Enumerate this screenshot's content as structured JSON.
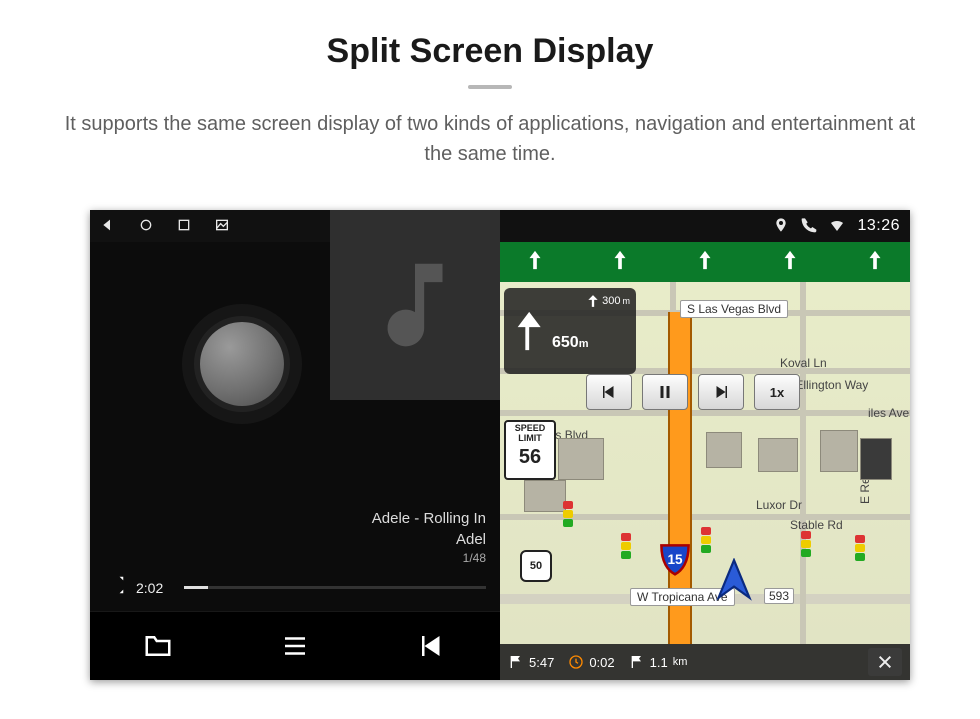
{
  "header": {
    "title": "Split Screen Display",
    "subtitle": "It supports the same screen display of two kinds of applications, navigation and entertainment at the same time."
  },
  "statusbar": {
    "time": "13:26",
    "icons_left": [
      "back-triangle",
      "circle",
      "square",
      "picture"
    ],
    "icons_right": [
      "location-pin",
      "phone",
      "wifi"
    ]
  },
  "music": {
    "track_line1": "Adele - Rolling In",
    "track_line2": "Adel",
    "index": "1/48",
    "elapsed": "2:02",
    "controls": [
      "folder",
      "playlist",
      "prev"
    ]
  },
  "nav": {
    "lane_arrows": 5,
    "turn": {
      "distance": "650",
      "distance_unit": "m",
      "next_distance": "300",
      "next_unit": "m"
    },
    "sim_controls": {
      "prev": "prev",
      "pause": "pause",
      "next": "next",
      "speed": "1x"
    },
    "speed_limit": {
      "label": "SPEED\nLIMIT",
      "value": "56"
    },
    "interstate": "15",
    "us_route": "50",
    "streets": {
      "top": "S Las Vegas Blvd",
      "koval": "Koval Ln",
      "duke": "Duke Ellington Way",
      "vegas_trunc": "Vegas Blvd",
      "luxor": "Luxor Dr",
      "stable": "Stable Rd",
      "reno": "E Reno Ave",
      "bottom": "W Tropicana Ave",
      "bottom_num": "593",
      "miles_trunc": "iles Ave"
    },
    "footer": {
      "eta": "5:47",
      "duration": "0:02",
      "distance": "1.1",
      "distance_unit": "km"
    }
  }
}
